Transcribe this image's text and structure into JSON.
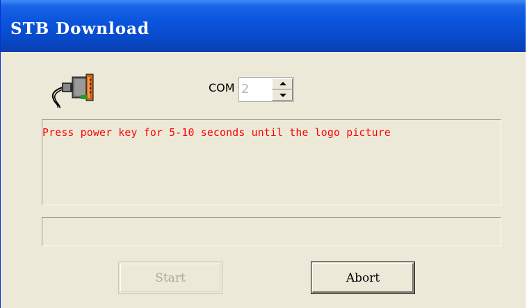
{
  "window": {
    "title": "STB Download"
  },
  "port": {
    "icon": "serial-port-icon",
    "label": "COM",
    "value": "2"
  },
  "message": {
    "text": "Press power key for 5-10 seconds until the logo picture",
    "color": "#ff0000"
  },
  "progress": {
    "percent": 0
  },
  "buttons": {
    "start_label": "Start",
    "abort_label": "Abort"
  },
  "colors": {
    "title_bar": "#0a55dd",
    "dialog_bg": "#ece9d8"
  }
}
